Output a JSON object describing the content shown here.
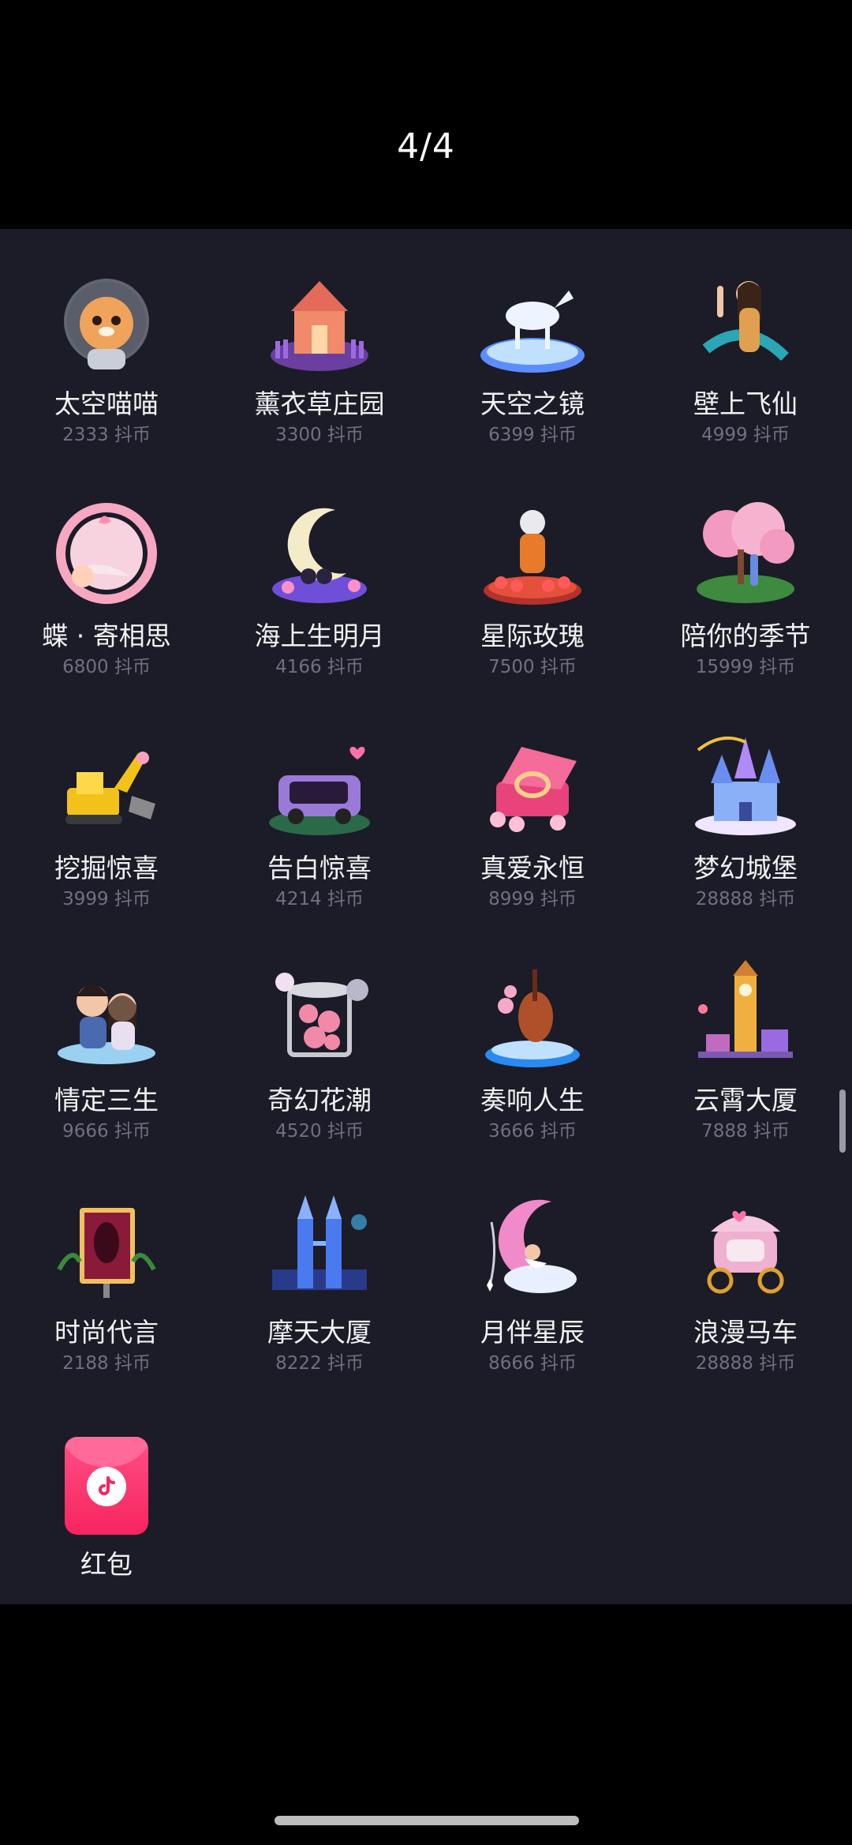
{
  "pager": {
    "text": "4/4"
  },
  "gifts": [
    {
      "name": "太空喵喵",
      "price": "2333 抖币",
      "icon": "space-cat-icon"
    },
    {
      "name": "薰衣草庄园",
      "price": "3300 抖币",
      "icon": "lavender-manor-icon"
    },
    {
      "name": "天空之镜",
      "price": "6399 抖币",
      "icon": "sky-mirror-horse-icon"
    },
    {
      "name": "壁上飞仙",
      "price": "4999 抖币",
      "icon": "flying-fairy-icon"
    },
    {
      "name": "蝶 · 寄相思",
      "price": "6800 抖币",
      "icon": "butterfly-frame-icon"
    },
    {
      "name": "海上生明月",
      "price": "4166 抖币",
      "icon": "crescent-moon-couple-icon"
    },
    {
      "name": "星际玫瑰",
      "price": "7500 抖币",
      "icon": "astronaut-roses-icon"
    },
    {
      "name": "陪你的季节",
      "price": "15999 抖币",
      "icon": "cherry-blossom-couple-icon"
    },
    {
      "name": "挖掘惊喜",
      "price": "3999 抖币",
      "icon": "excavator-icon"
    },
    {
      "name": "告白惊喜",
      "price": "4214 抖币",
      "icon": "love-car-icon"
    },
    {
      "name": "真爱永恒",
      "price": "8999 抖币",
      "icon": "ring-box-icon"
    },
    {
      "name": "梦幻城堡",
      "price": "28888 抖币",
      "icon": "fantasy-castle-icon"
    },
    {
      "name": "情定三生",
      "price": "9666 抖币",
      "icon": "couple-portrait-icon"
    },
    {
      "name": "奇幻花潮",
      "price": "4520 抖币",
      "icon": "flower-cage-icon"
    },
    {
      "name": "奏响人生",
      "price": "3666 抖币",
      "icon": "violin-stage-icon"
    },
    {
      "name": "云霄大厦",
      "price": "7888 抖币",
      "icon": "clock-tower-icon"
    },
    {
      "name": "时尚代言",
      "price": "2188 抖币",
      "icon": "billboard-icon"
    },
    {
      "name": "摩天大厦",
      "price": "8222 抖币",
      "icon": "twin-towers-icon"
    },
    {
      "name": "月伴星辰",
      "price": "8666 抖币",
      "icon": "moon-swing-icon"
    },
    {
      "name": "浪漫马车",
      "price": "28888 抖币",
      "icon": "carriage-icon"
    }
  ],
  "redpacket": {
    "label": "红包",
    "icon": "red-packet-icon"
  },
  "colors": {
    "panel": "#1b1c27",
    "name_text": "#f2f2f4",
    "price_text": "#6f7180",
    "accent_pink": "#f7245f"
  }
}
